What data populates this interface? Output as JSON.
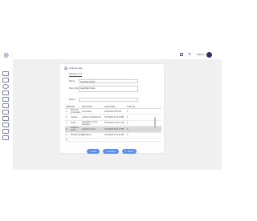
{
  "header": {
    "user_name": "admin",
    "colors": {
      "accent": "#3a4a9a",
      "avatar": "#28306e",
      "button": "#5b8def"
    }
  },
  "card": {
    "title": "Categories",
    "tab": "Category Fd",
    "form": {
      "name_label": "Name",
      "name_value": "Graphite Cards",
      "description_label": "Description",
      "description_value": "Graphite Cards",
      "parent_label": "Parent"
    },
    "table": {
      "headers": [
        "Cat#",
        "Title",
        "Description",
        "Added Date",
        "Ordering"
      ],
      "rows": [
        {
          "num": "1",
          "title": "Personal Computers",
          "desc": "Computers",
          "date": "2/24/2024 2:55 PM",
          "order": "1"
        },
        {
          "num": "2",
          "title": "Laptops",
          "desc": "Laptops & Notebooks",
          "date": "3/27/2023 1:29:16 PM",
          "order": "2"
        },
        {
          "num": "3",
          "title": "Audio",
          "desc": "Headsets & Audio Solutions",
          "date": "7/10/2023 7:35:07 AM",
          "order": "3"
        },
        {
          "num": "4",
          "title": "Graphics Cards",
          "desc": "Graphics Cards",
          "date": "7/15/2023 8:20:17 PM",
          "order": "4"
        },
        {
          "num": "5",
          "title": "CPU/Processors",
          "desc": "Processors",
          "date": "7/15/2023 7:20:41 PM",
          "order": "5"
        },
        {
          "num": "6",
          "title": "",
          "desc": "",
          "date": "",
          "order": ""
        }
      ]
    },
    "buttons": {
      "add": "Add",
      "update": "Update",
      "delete": "Delete"
    }
  }
}
